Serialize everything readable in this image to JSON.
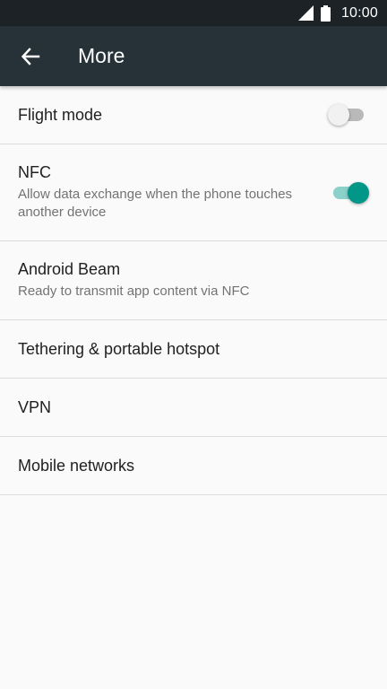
{
  "status_bar": {
    "time": "10:00",
    "signal_icon": "signal-icon",
    "battery_icon": "battery-icon"
  },
  "app_bar": {
    "title": "More",
    "back_icon": "arrow-left-icon"
  },
  "items": [
    {
      "title": "Flight mode",
      "subtitle": "",
      "toggle": "off"
    },
    {
      "title": "NFC",
      "subtitle": "Allow data exchange when the phone touches another device",
      "toggle": "on"
    },
    {
      "title": "Android Beam",
      "subtitle": "Ready to transmit app content via NFC"
    },
    {
      "title": "Tethering & portable hotspot"
    },
    {
      "title": "VPN"
    },
    {
      "title": "Mobile networks"
    }
  ],
  "colors": {
    "status_bar": "#1c2226",
    "app_bar": "#263238",
    "accent": "#009688",
    "background": "#fafafa"
  }
}
